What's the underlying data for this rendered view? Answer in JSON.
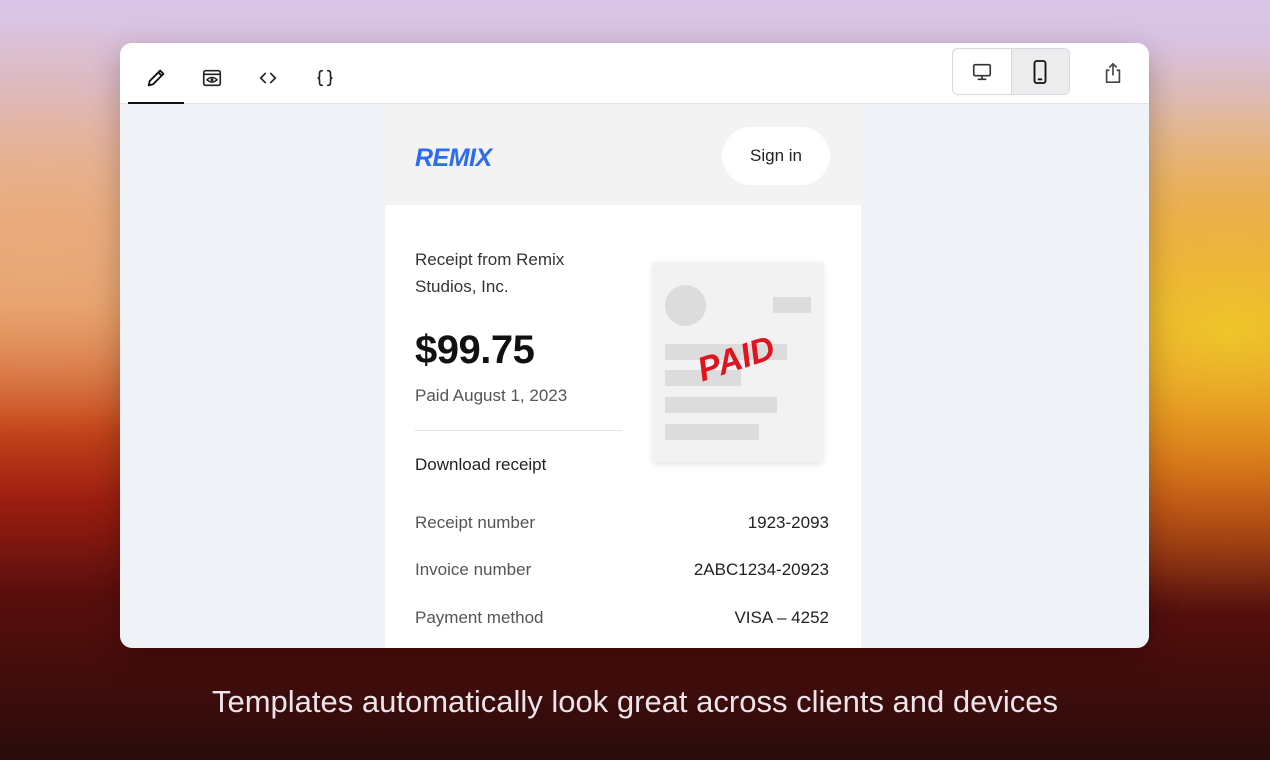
{
  "toolbar": {
    "tools": [
      {
        "icon": "pencil-icon",
        "active": true
      },
      {
        "icon": "eye-preview-icon",
        "active": false
      },
      {
        "icon": "code-brackets-icon",
        "active": false
      },
      {
        "icon": "curly-braces-icon",
        "active": false
      }
    ],
    "devices": [
      {
        "icon": "desktop-icon",
        "selected": false
      },
      {
        "icon": "mobile-icon",
        "selected": true
      }
    ],
    "share_icon": "share-icon"
  },
  "email": {
    "logo": "REMIX",
    "sign_in": "Sign in",
    "receipt_from": "Receipt from Remix Studios, Inc.",
    "amount": "$99.75",
    "paid_date": "Paid August 1, 2023",
    "download": "Download receipt",
    "stamp": "PAID",
    "details": [
      {
        "label": "Receipt number",
        "value": "1923-2093"
      },
      {
        "label": "Invoice number",
        "value": "2ABC1234-20923"
      },
      {
        "label": "Payment method",
        "value": "VISA – 4252"
      }
    ]
  },
  "colors": {
    "logo": "#2b6cf0",
    "stamp": "#e0141e"
  },
  "caption": "Templates automatically look great across clients and devices"
}
